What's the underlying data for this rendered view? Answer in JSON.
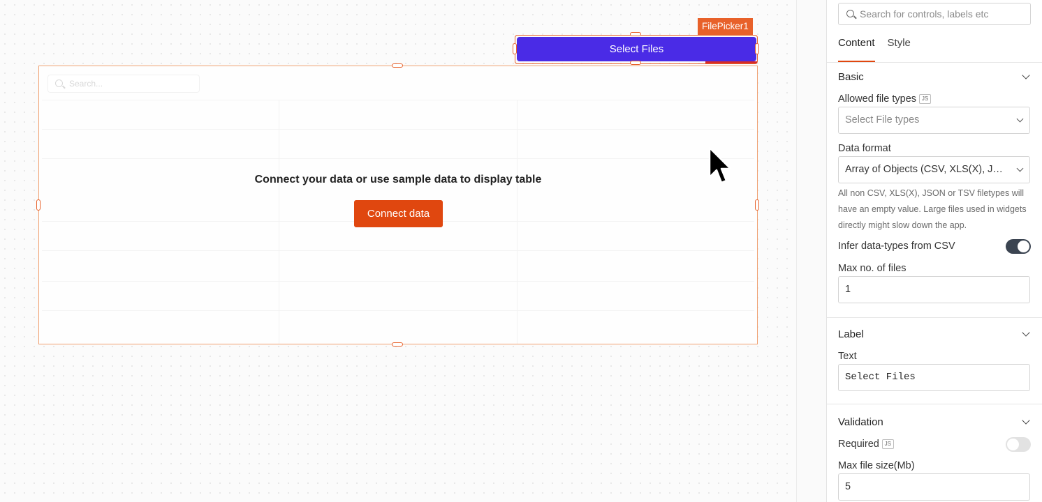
{
  "canvas": {
    "filepicker": {
      "widget_name": "FilePicker1",
      "button_label": "Select Files"
    },
    "table": {
      "search_placeholder": "Search...",
      "empty_message": "Connect your data or use sample data to display table",
      "connect_button_label": "Connect data"
    }
  },
  "pane": {
    "search_placeholder": "Search for controls, labels etc",
    "tabs": [
      {
        "label": "Content",
        "active": true
      },
      {
        "label": "Style",
        "active": false
      }
    ],
    "basic": {
      "title": "Basic",
      "allowed_file_types": {
        "label": "Allowed file types",
        "js_badge": "JS",
        "placeholder": "Select File types"
      },
      "data_format": {
        "label": "Data format",
        "value": "Array of Objects (CSV, XLS(X), JSON, TSV)"
      },
      "help_text": "All non CSV, XLS(X), JSON or TSV filetypes will have an empty value. Large files used in widgets directly might slow down the app.",
      "infer_types": {
        "label": "Infer data-types from CSV",
        "enabled": true
      },
      "max_files": {
        "label": "Max no. of files",
        "value": "1"
      }
    },
    "label_section": {
      "title": "Label",
      "text": {
        "label": "Text",
        "value": "Select Files"
      }
    },
    "validation": {
      "title": "Validation",
      "required": {
        "label": "Required",
        "js_badge": "JS",
        "enabled": false
      },
      "max_file_size": {
        "label": "Max file size(Mb)",
        "value": "5"
      }
    }
  },
  "colors": {
    "accent": "#e0470f",
    "widget_outline": "#e8612a",
    "filepicker_button": "#4a2be6",
    "toggle_on": "#3b4451"
  }
}
